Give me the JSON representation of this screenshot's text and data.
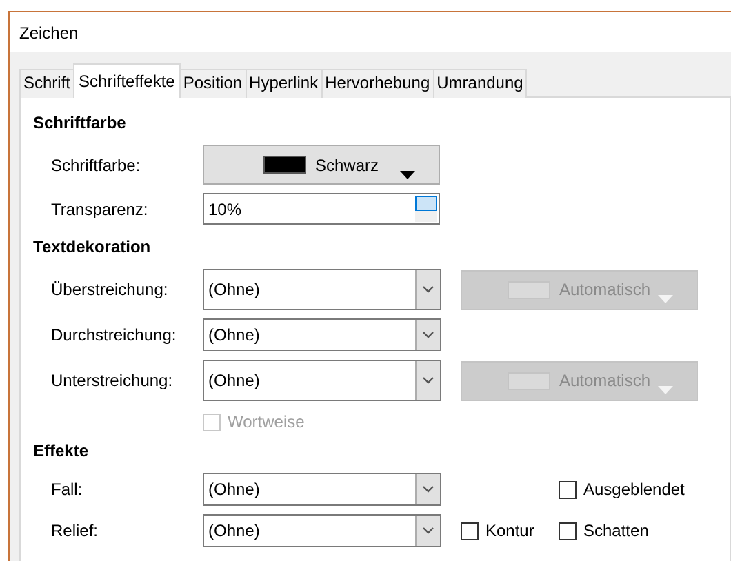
{
  "window": {
    "title": "Zeichen"
  },
  "tabs": [
    {
      "label": "Schrift",
      "selected": false
    },
    {
      "label": "Schrifteffekte",
      "selected": true
    },
    {
      "label": "Position",
      "selected": false
    },
    {
      "label": "Hyperlink",
      "selected": false
    },
    {
      "label": "Hervorhebung",
      "selected": false
    },
    {
      "label": "Umrandung",
      "selected": false
    }
  ],
  "sections": [
    {
      "heading": "Schriftfarbe",
      "rows": [
        {
          "kind": "color",
          "label": "Schriftfarbe:",
          "value": "Schwarz"
        },
        {
          "kind": "spin",
          "label": "Transparenz:",
          "value": "10%"
        }
      ]
    },
    {
      "heading": "Textdekoration",
      "rows": [
        {
          "kind": "combo",
          "label": "Überstreichung:",
          "value": "(Ohne)",
          "color_select": {
            "value": "Automatisch",
            "disabled": true
          }
        },
        {
          "kind": "combo",
          "label": "Durchstreichung:",
          "value": "(Ohne)"
        },
        {
          "kind": "combo",
          "label": "Unterstreichung:",
          "value": "(Ohne)",
          "color_select": {
            "value": "Automatisch",
            "disabled": true
          }
        },
        {
          "kind": "check",
          "checks": [
            {
              "label": "Wortweise",
              "checked": false,
              "disabled": true
            }
          ]
        }
      ]
    },
    {
      "heading": "Effekte",
      "rows": [
        {
          "kind": "combo",
          "label": "Fall:",
          "value": "(Ohne)",
          "checks": [
            {
              "label": "Ausgeblendet",
              "checked": false,
              "disabled": false
            }
          ]
        },
        {
          "kind": "combo",
          "label": "Relief:",
          "value": "(Ohne)",
          "checks": [
            {
              "label": "Kontur",
              "checked": false,
              "disabled": false
            },
            {
              "label": "Schatten",
              "checked": false,
              "disabled": false
            }
          ]
        }
      ]
    }
  ]
}
